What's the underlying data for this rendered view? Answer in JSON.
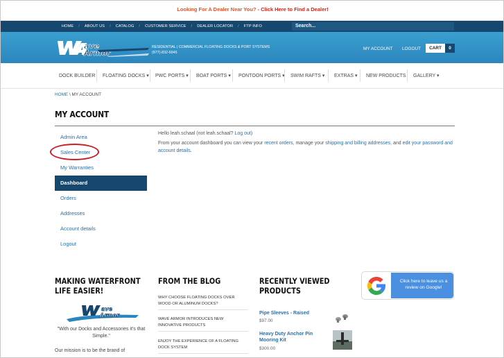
{
  "promo": {
    "question": "Looking For A Dealer Near You?",
    "separator": " - ",
    "cta": "Click Here to Find a Dealer!"
  },
  "topnav": {
    "items": [
      "HOME",
      "ABOUT US",
      "CATALOG",
      "CUSTOMER SERVICE",
      "DEALER LOCATOR",
      "FTP INFO"
    ],
    "separator": "/",
    "search_placeholder": "Search..."
  },
  "header": {
    "logo_text": "Wave Armor",
    "line1": "RESIDENTIAL | COMMERCIAL FLOATING DOCKS & PORT SYSTEMS",
    "phone": "(877)-832-6945",
    "my_account": "MY ACCOUNT",
    "logout": "LOGOUT",
    "cart": "CART",
    "cart_count": "0"
  },
  "mainnav": {
    "items": [
      {
        "label": "DOCK BUILDER",
        "caret": ""
      },
      {
        "label": "FLOATING DOCKS",
        "caret": "▾"
      },
      {
        "label": "PWC PORTS",
        "caret": "▾"
      },
      {
        "label": "BOAT PORTS",
        "caret": "▾"
      },
      {
        "label": "PONTOON PORTS",
        "caret": "▾"
      },
      {
        "label": "SWIM RAFTS",
        "caret": "▾"
      },
      {
        "label": "EXTRAS",
        "caret": "▾"
      },
      {
        "label": "NEW PRODUCTS",
        "caret": ""
      },
      {
        "label": "GALLERY",
        "caret": "▾"
      }
    ]
  },
  "breadcrumb": {
    "home": "HOME",
    "sep": " \\ ",
    "current": "MY ACCOUNT"
  },
  "page_title": "MY ACCOUNT",
  "sidemenu": {
    "items": [
      "Admin Area",
      "Sales Center",
      "My Warranties",
      "Dashboard",
      "Orders",
      "Addresses",
      "Account details",
      "Logout"
    ],
    "active_index": 3,
    "highlighted": "Sales Center"
  },
  "content": {
    "hello": "Hello leah.schaal (not leah.schaal? ",
    "logout_link": "Log out",
    "hello_end": ")",
    "p1": "From your account dashboard you can view your ",
    "recent_orders": "recent orders",
    "p2": ", manage your ",
    "addresses": "shipping and billing addresses",
    "p3": ", and ",
    "edit_link": "edit your password and account details",
    "p4": "."
  },
  "footer": {
    "col1_title": "MAKING WATERFRONT LIFE EASIER!",
    "col1_quote": "\"With our Docks and Accessories it's that Simple.\"",
    "col1_mission": "Our mission is to be the brand of",
    "col2_title": "FROM THE BLOG",
    "blog_posts": [
      "WHY CHOOSE FLOATING DOCKS OVER WOOD OR ALUMINUM DOCKS?",
      "WAVE ARMOR INTRODUCES NEW INNOVATIVE PRODUCTS",
      "ENJOY THE EXPERIENCE OF A FLOATING DOCK SYSTEM"
    ],
    "col3_title": "RECENTLY VIEWED PRODUCTS",
    "products": [
      {
        "name": "Pipe Sleeves - Raised",
        "price": "$97.00"
      },
      {
        "name": "Heavy Duty Anchor Pin Mooring Kit",
        "price": "$300.00"
      }
    ],
    "review_text": "Click here to leave us a review on Google!"
  },
  "colors": {
    "navy": "#16476f",
    "header_blue": "#2b86bd",
    "link": "#2a6fa8",
    "promo_red": "#d0261c",
    "circle_red": "#c81e26",
    "google_blue": "#4a8fe0"
  }
}
